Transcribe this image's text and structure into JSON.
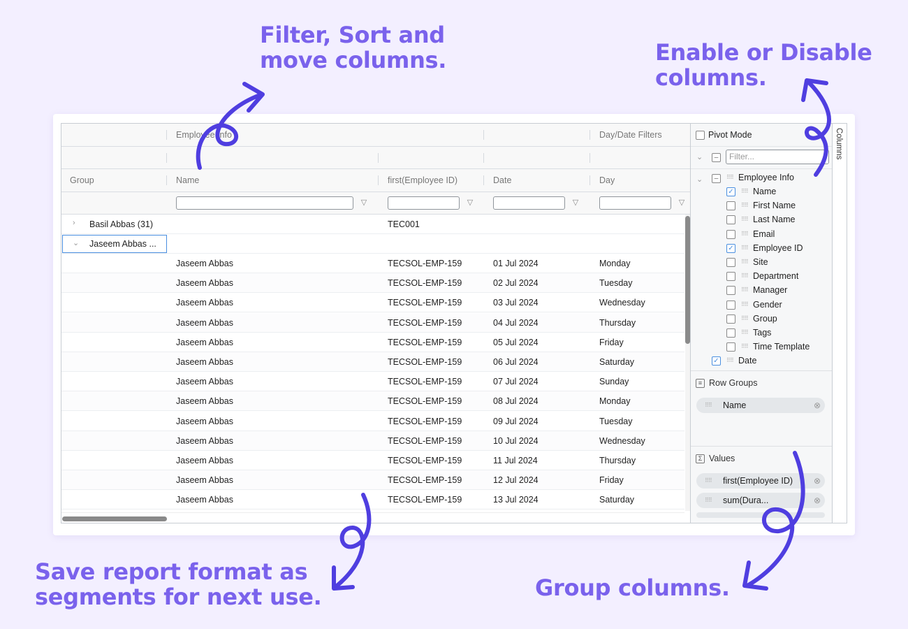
{
  "callouts": {
    "filter": [
      "Filter, Sort and",
      "move columns."
    ],
    "enable": [
      "Enable or Disable",
      "columns."
    ],
    "save": [
      "Save report format as",
      "segments for next use."
    ],
    "group": [
      "Group columns."
    ]
  },
  "grid": {
    "group_headers": [
      "Employee Info",
      "Day/Date Filters"
    ],
    "columns": [
      "Group",
      "Name",
      "first(Employee ID)",
      "Date",
      "Day"
    ],
    "group_rows": [
      {
        "label": "Basil Abbas (31)",
        "employee_id": "TEC001",
        "expanded": false
      },
      {
        "label": "Jaseem Abbas ...",
        "employee_id": "",
        "expanded": true
      }
    ],
    "rows": [
      {
        "name": "Jaseem Abbas",
        "id": "TECSOL-EMP-159",
        "date": "01 Jul 2024",
        "day": "Monday"
      },
      {
        "name": "Jaseem Abbas",
        "id": "TECSOL-EMP-159",
        "date": "02 Jul 2024",
        "day": "Tuesday"
      },
      {
        "name": "Jaseem Abbas",
        "id": "TECSOL-EMP-159",
        "date": "03 Jul 2024",
        "day": "Wednesday"
      },
      {
        "name": "Jaseem Abbas",
        "id": "TECSOL-EMP-159",
        "date": "04 Jul 2024",
        "day": "Thursday"
      },
      {
        "name": "Jaseem Abbas",
        "id": "TECSOL-EMP-159",
        "date": "05 Jul 2024",
        "day": "Friday"
      },
      {
        "name": "Jaseem Abbas",
        "id": "TECSOL-EMP-159",
        "date": "06 Jul 2024",
        "day": "Saturday"
      },
      {
        "name": "Jaseem Abbas",
        "id": "TECSOL-EMP-159",
        "date": "07 Jul 2024",
        "day": "Sunday"
      },
      {
        "name": "Jaseem Abbas",
        "id": "TECSOL-EMP-159",
        "date": "08 Jul 2024",
        "day": "Monday"
      },
      {
        "name": "Jaseem Abbas",
        "id": "TECSOL-EMP-159",
        "date": "09 Jul 2024",
        "day": "Tuesday"
      },
      {
        "name": "Jaseem Abbas",
        "id": "TECSOL-EMP-159",
        "date": "10 Jul 2024",
        "day": "Wednesday"
      },
      {
        "name": "Jaseem Abbas",
        "id": "TECSOL-EMP-159",
        "date": "11 Jul 2024",
        "day": "Thursday"
      },
      {
        "name": "Jaseem Abbas",
        "id": "TECSOL-EMP-159",
        "date": "12 Jul 2024",
        "day": "Friday"
      },
      {
        "name": "Jaseem Abbas",
        "id": "TECSOL-EMP-159",
        "date": "13 Jul 2024",
        "day": "Saturday"
      }
    ]
  },
  "panel": {
    "pivot_mode_label": "Pivot Mode",
    "filter_placeholder": "Filter...",
    "side_tab": "Columns",
    "tree_group": "Employee Info",
    "columns": [
      {
        "label": "Name",
        "checked": true
      },
      {
        "label": "First Name",
        "checked": false
      },
      {
        "label": "Last Name",
        "checked": false
      },
      {
        "label": "Email",
        "checked": false
      },
      {
        "label": "Employee ID",
        "checked": true
      },
      {
        "label": "Site",
        "checked": false
      },
      {
        "label": "Department",
        "checked": false
      },
      {
        "label": "Manager",
        "checked": false
      },
      {
        "label": "Gender",
        "checked": false
      },
      {
        "label": "Group",
        "checked": false
      },
      {
        "label": "Tags",
        "checked": false
      },
      {
        "label": "Time Template",
        "checked": false
      }
    ],
    "date_item": {
      "label": "Date",
      "checked": true
    },
    "row_groups_title": "Row Groups",
    "row_groups": [
      "Name"
    ],
    "values_title": "Values",
    "values": [
      "first(Employee ID)",
      "sum(Dura..."
    ]
  },
  "colors": {
    "accent": "#7a62ec",
    "arrow": "#4f3ee0",
    "check": "#4a8fe0"
  }
}
